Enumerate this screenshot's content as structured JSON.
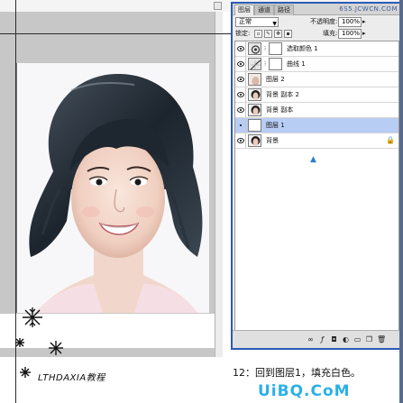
{
  "canvas": {
    "photo_alt": "portrait"
  },
  "layers_panel": {
    "tabs": [
      "图层",
      "通道",
      "路径"
    ],
    "watermark": "6S5.JCWCN.COM",
    "blend_mode": "正常",
    "opacity_label": "不透明度:",
    "opacity_value": "100%",
    "lock_label": "锁定:",
    "fill_label": "填充:",
    "fill_value": "100%",
    "layers": [
      {
        "name": "选取颜色 1",
        "kind": "adjustment",
        "selected": false,
        "locked": false
      },
      {
        "name": "曲线 1",
        "kind": "adjustment",
        "selected": false,
        "locked": false
      },
      {
        "name": "图层 2",
        "kind": "pixel",
        "selected": false,
        "locked": false
      },
      {
        "name": "背景 副本 2",
        "kind": "photo",
        "selected": false,
        "locked": false
      },
      {
        "name": "背景 副本",
        "kind": "photo",
        "selected": false,
        "locked": false
      },
      {
        "name": "图层 1",
        "kind": "blank",
        "selected": true,
        "locked": false
      },
      {
        "name": "背景",
        "kind": "photo",
        "selected": false,
        "locked": true
      }
    ],
    "footer_icons": [
      "link-icon",
      "fx-icon",
      "mask-icon",
      "adjustment-icon",
      "group-icon",
      "new-layer-icon",
      "trash-icon"
    ]
  },
  "caption": {
    "brand": "LTHDAXIA教程",
    "step": "12：回到图层1，填充白色。",
    "logo": "UiBQ.CoM"
  },
  "colors": {
    "accent": "#2b5bb8",
    "logo": "#2bb0e8",
    "selection": "#b8cdf4"
  }
}
